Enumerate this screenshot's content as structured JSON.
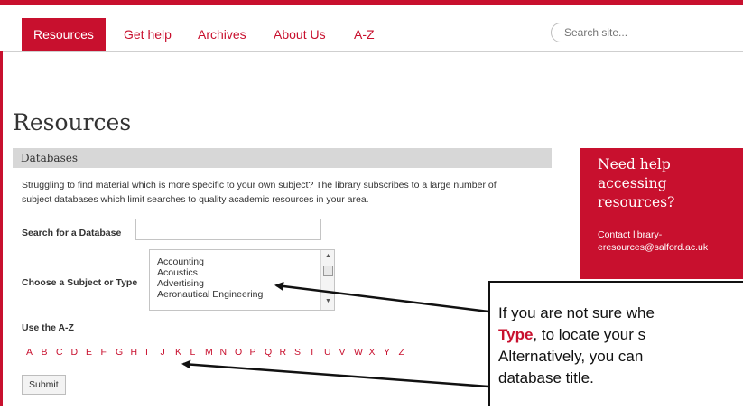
{
  "nav": {
    "items": [
      "Resources",
      "Get help",
      "Archives",
      "About Us",
      "A-Z"
    ],
    "search_placeholder": "Search site..."
  },
  "page": {
    "title": "Resources"
  },
  "databases": {
    "heading": "Databases",
    "intro_line1": "Struggling to find material which is more specific to your own subject? The library subscribes to a large number of",
    "intro_line2": "subject databases which limit searches to quality academic resources in your area.",
    "search_label": "Search for a Database",
    "subject_label": "Choose a Subject or Type",
    "subject_options": [
      "Accounting",
      "Acoustics",
      "Advertising",
      "Aeronautical Engineering"
    ],
    "az_label": "Use the A-Z",
    "az_letters": [
      "A",
      "B",
      "C",
      "D",
      "E",
      "F",
      "G",
      "H",
      "I",
      "J",
      "K",
      "L",
      "M",
      "N",
      "O",
      "P",
      "Q",
      "R",
      "S",
      "T",
      "U",
      "V",
      "W",
      "X",
      "Y",
      "Z"
    ],
    "submit_label": "Submit"
  },
  "help": {
    "title": "Need help accessing resources?",
    "text_line1": "Contact library-",
    "text_line2": "eresources@salford.ac.uk"
  },
  "callout": {
    "line1": "If you are not sure whe",
    "line2_highlight": "Type",
    "line2_rest": ", to locate your s",
    "line3": "Alternatively, you can",
    "line4": "database title."
  },
  "colors": {
    "brand": "#c8102e",
    "panel_header": "#d7d7d7"
  }
}
